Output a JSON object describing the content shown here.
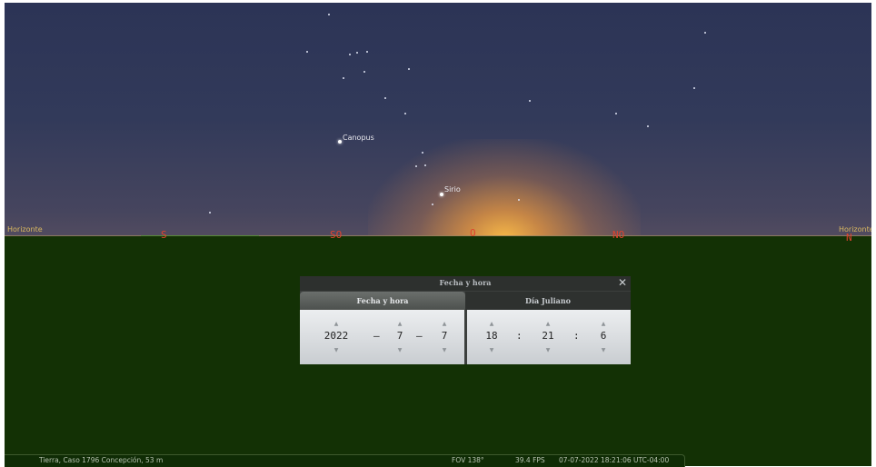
{
  "sky": {
    "stars": [
      {
        "label": "Canopus"
      },
      {
        "label": "Sirio"
      }
    ],
    "horizon_label_left": "Horizonte",
    "horizon_label_right": "Horizonte",
    "cardinals": {
      "s": "S",
      "so": "SO",
      "o": "O",
      "no": "NO",
      "n": "N"
    }
  },
  "date_dialog": {
    "title": "Fecha y hora",
    "tabs": {
      "date_time": "Fecha y hora",
      "julian_day": "Día Juliano"
    },
    "year": "2022",
    "month": "7",
    "day": "7",
    "hour": "18",
    "minute": "21",
    "second": "6",
    "date_separator": "–",
    "time_separator": ":",
    "close_icon": "close-icon",
    "spin_up_icon": "caret-up-icon",
    "spin_down_icon": "caret-down-icon"
  },
  "status_bar": {
    "location": "Tierra, Caso 1796 Concepción, 53 m",
    "fov": "FOV 138°",
    "fps": "39.4 FPS",
    "datetime": "07-07-2022 18:21:06 UTC-04:00"
  },
  "colors": {
    "ground": "#133105",
    "cardinal": "#e0432d",
    "horizon_label": "#d9b860",
    "sky_top": "#2c3456"
  }
}
